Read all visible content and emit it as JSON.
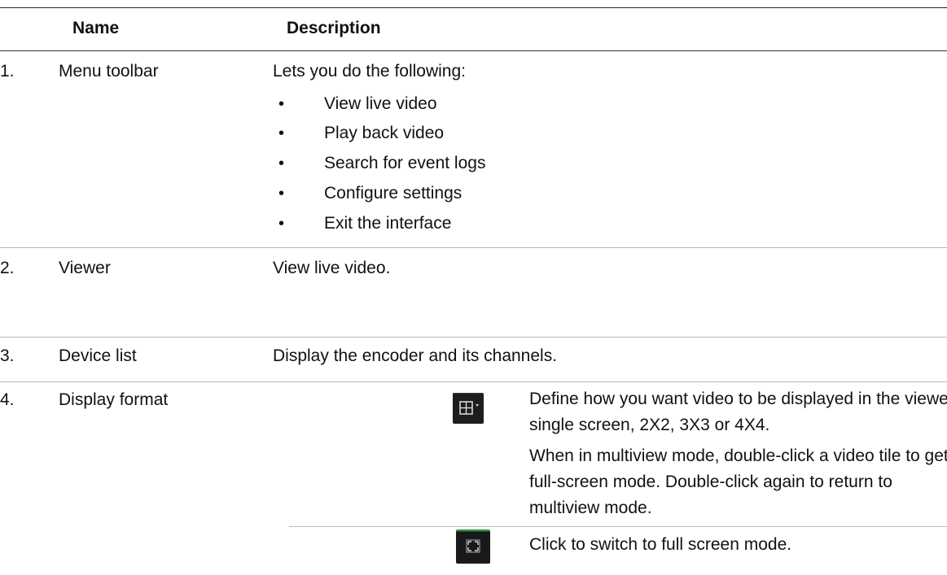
{
  "header": {
    "name_label": "Name",
    "description_label": "Description"
  },
  "rows": [
    {
      "number": "1.",
      "name": "Menu toolbar",
      "description": "Lets you do the following:",
      "bullets": [
        "View live video",
        "Play back video",
        "Search for event logs",
        "Configure settings",
        "Exit the interface"
      ]
    },
    {
      "number": "2.",
      "name": "Viewer",
      "description": "View live video."
    },
    {
      "number": "3.",
      "name": "Device list",
      "description": "Display the encoder and its channels."
    },
    {
      "number": "4.",
      "name": "Display format",
      "items": [
        {
          "icon": "grid-layout-icon",
          "lines": [
            "Define how you want video to be displayed in the viewer;",
            "single screen, 2X2, 3X3 or 4X4.",
            "When in multiview mode, double-click a video tile to get",
            "full-screen mode. Double-click again to return to",
            "multiview mode."
          ]
        },
        {
          "icon": "fullscreen-icon",
          "lines": [
            "Click to switch to full screen mode."
          ]
        }
      ]
    }
  ],
  "colors": {
    "icon_background": "#1b1d1f",
    "fullscreen_accent": "#2f9a37"
  }
}
